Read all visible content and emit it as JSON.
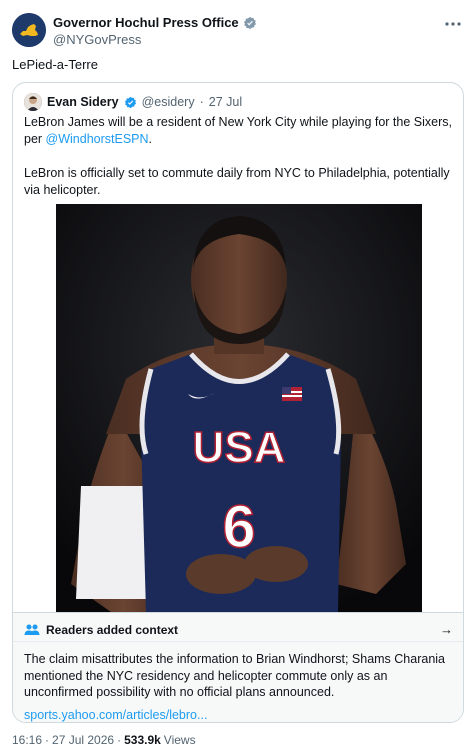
{
  "post": {
    "author_name": "Governor Hochul Press Office",
    "author_handle": "@NYGovPress",
    "more_icon": "more-horizontal-icon",
    "text": "LePied-a-Terre"
  },
  "quote": {
    "author_name": "Evan Sidery",
    "author_handle": "@esidery",
    "separator": "·",
    "date": "27 Jul",
    "line1_prefix": "LeBron James will be a resident of New York City while playing for the Sixers, per ",
    "line1_mention": "@WindhorstESPN",
    "line1_suffix": ".",
    "line2": "LeBron is officially set to commute daily from NYC to Philadelphia, potentially via helicopter.",
    "jersey_text": "USA",
    "jersey_number": "6"
  },
  "context": {
    "icon": "people-icon",
    "title": "Readers added context",
    "arrow": "→",
    "body": "The claim misattributes the information to Brian Windhorst; Shams Charania mentioned the NYC residency and helicopter commute only as an unconfirmed possibility with no official plans announced.",
    "link": "sports.yahoo.com/articles/lebro..."
  },
  "meta": {
    "time": "16:16",
    "sep1": "·",
    "date": "27 Jul 2026",
    "sep2": "·",
    "views_count": "533.9k",
    "views_label": "Views"
  },
  "colors": {
    "accent": "#1d9bf0",
    "verified_gray": "#829aab",
    "jersey_navy": "#1c2a5a"
  }
}
